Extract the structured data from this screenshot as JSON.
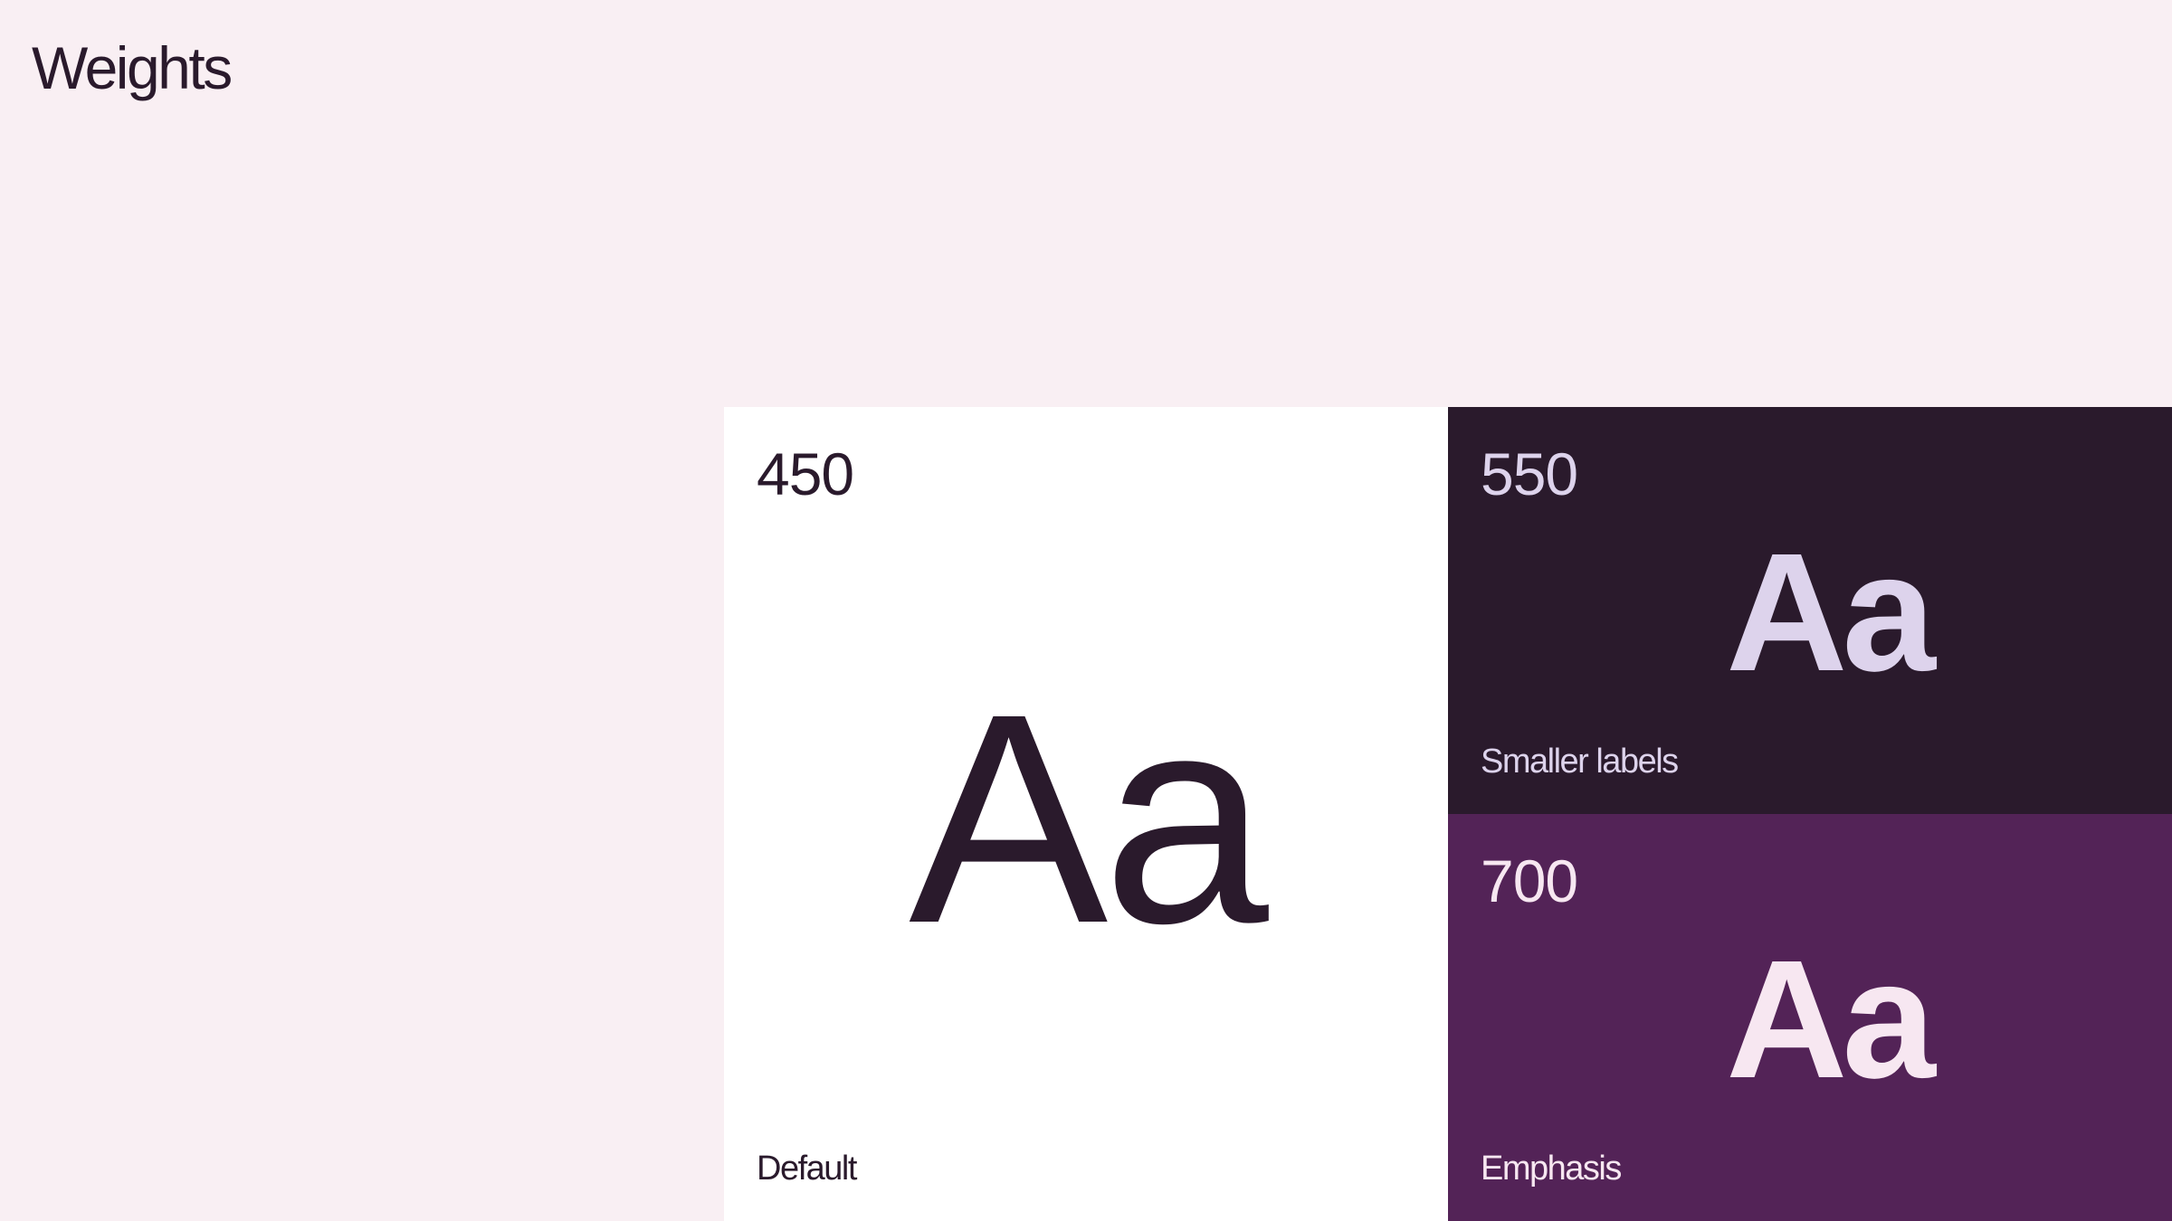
{
  "page": {
    "title": "Weights"
  },
  "cards": [
    {
      "weight": "450",
      "specimen": "Aa",
      "label": "Default",
      "background": "#ffffff",
      "text_color": "#2a1a2c"
    },
    {
      "weight": "550",
      "specimen": "Aa",
      "label": "Smaller labels",
      "background": "#2a1a2c",
      "text_color": "#ddd3ec"
    },
    {
      "weight": "700",
      "specimen": "Aa",
      "label": "Emphasis",
      "background": "#532357",
      "text_color": "#f7e7f1"
    }
  ],
  "colors": {
    "page_background": "#f9eff3",
    "ink": "#2a1a2c"
  }
}
